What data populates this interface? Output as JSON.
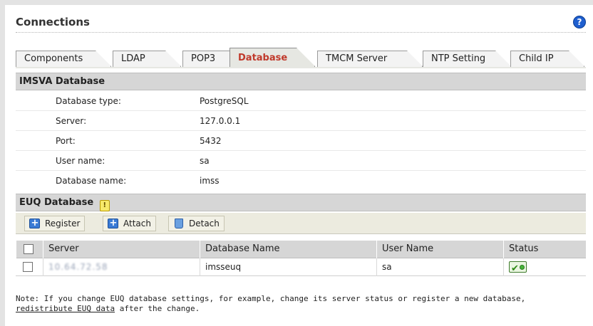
{
  "header": {
    "title": "Connections",
    "help_icon": "help-icon"
  },
  "tabs": [
    {
      "label": "Components",
      "active": false
    },
    {
      "label": "LDAP",
      "active": false
    },
    {
      "label": "POP3",
      "active": false
    },
    {
      "label": "Database",
      "active": true
    },
    {
      "label": "TMCM Server",
      "active": false
    },
    {
      "label": "NTP Setting",
      "active": false
    },
    {
      "label": "Child IP",
      "active": false
    }
  ],
  "imsva_section": {
    "title": "IMSVA Database",
    "fields": [
      {
        "label": "Database type:",
        "value": "PostgreSQL"
      },
      {
        "label": "Server:",
        "value": "127.0.0.1"
      },
      {
        "label": "Port:",
        "value": "5432"
      },
      {
        "label": "User name:",
        "value": "sa"
      },
      {
        "label": "Database name:",
        "value": "imss"
      }
    ]
  },
  "euq_section": {
    "title": "EUQ Database",
    "note_icon": "note-icon",
    "toolbar": {
      "register_label": "Register",
      "attach_label": "Attach",
      "detach_label": "Detach"
    },
    "columns": [
      "Server",
      "Database Name",
      "User Name",
      "Status"
    ],
    "rows": [
      {
        "server": "10.64.72.58",
        "database_name": "imsseuq",
        "user_name": "sa",
        "status_icon": "status-ok-icon"
      }
    ]
  },
  "note": {
    "text": "Note: If you change EUQ database settings, for example, change its server status or register a new database,",
    "link_text": "redistribute EUQ data",
    "text_after": " after the change."
  },
  "colors": {
    "active_tab_text": "#c0392b",
    "section_bar": "#d6d6d6",
    "toolbar_bg": "#ecebdf",
    "help_icon": "#1f5fcf"
  }
}
